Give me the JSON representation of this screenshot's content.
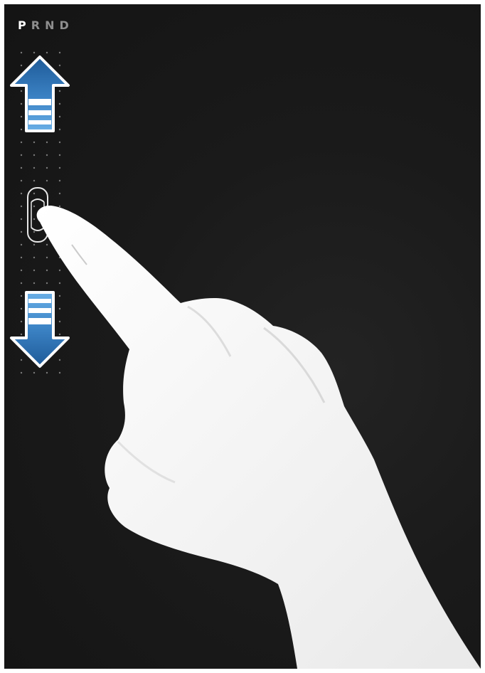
{
  "gear_selector": {
    "gears": [
      "P",
      "R",
      "N",
      "D"
    ],
    "active": "P"
  },
  "controls": {
    "up_arrow_icon": "arrow-up-icon",
    "down_arrow_icon": "arrow-down-icon",
    "car_icon": "car-icon"
  },
  "colors": {
    "background": "#171717",
    "arrow_blue": "#2f6fb0",
    "arrow_light": "#5aa0dc",
    "active_gear": "#ffffff",
    "inactive_gear": "#8e8e8e"
  }
}
